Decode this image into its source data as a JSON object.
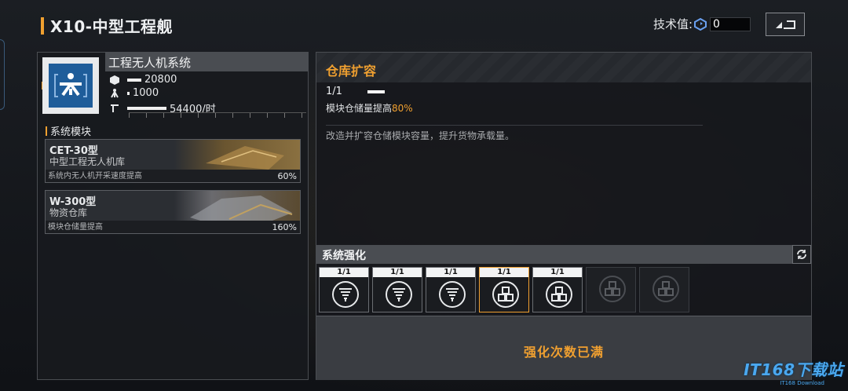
{
  "header": {
    "title": "X10-中型工程舰"
  },
  "tech": {
    "label": "技术值:",
    "value": "0"
  },
  "system": {
    "name": "工程无人机系统",
    "stats": [
      {
        "icon": "cube-icon",
        "value": "20800"
      },
      {
        "icon": "drone-icon",
        "value": "1000"
      },
      {
        "icon": "crane-icon",
        "value": "54400/时"
      }
    ]
  },
  "modules": {
    "section_label": "系统模块",
    "items": [
      {
        "name": "CET-30型",
        "type": "中型工程无人机库",
        "desc": "系统内无人机开采速度提高",
        "value": "60%"
      },
      {
        "name": "W-300型",
        "type": "物资仓库",
        "desc": "模块仓储量提高",
        "value": "160%"
      }
    ]
  },
  "upgrade": {
    "title": "仓库扩容",
    "level": "1/1",
    "effect_prefix": "模块仓储量提高",
    "effect_value": "80%",
    "description": "改造并扩容仓储模块容量，提升货物承载量。"
  },
  "enhance": {
    "title": "系统强化",
    "slots": [
      {
        "level": "1/1",
        "icon": "drill-icon",
        "state": "unlocked"
      },
      {
        "level": "1/1",
        "icon": "drill-icon",
        "state": "unlocked"
      },
      {
        "level": "1/1",
        "icon": "drill-icon",
        "state": "unlocked"
      },
      {
        "level": "1/1",
        "icon": "cubes-icon",
        "state": "selected"
      },
      {
        "level": "1/1",
        "icon": "cubes-icon",
        "state": "unlocked"
      },
      {
        "level": "",
        "icon": "cubes-icon",
        "state": "locked"
      },
      {
        "level": "",
        "icon": "cubes-icon",
        "state": "locked"
      }
    ],
    "max_text": "强化次数已满"
  },
  "watermark": {
    "main": "IT168下载站",
    "sub": "IT168 Download"
  },
  "colors": {
    "accent": "#f0a030",
    "icon_bg": "#1f5d9a",
    "watermark": "#4aa8f0"
  }
}
